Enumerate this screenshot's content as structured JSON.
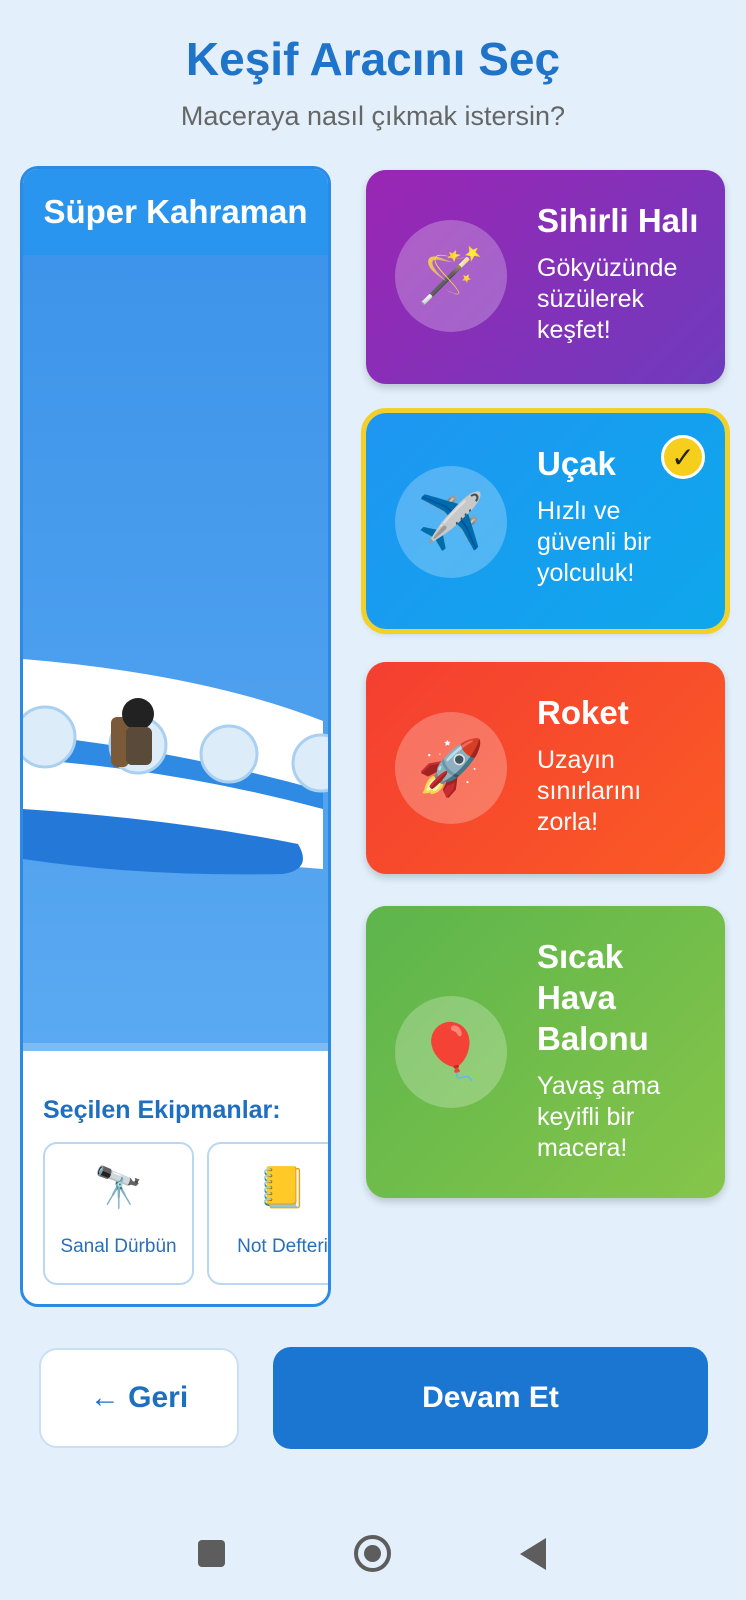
{
  "header": {
    "title": "Keşif Aracını Seç",
    "subtitle": "Maceraya nasıl çıkmak istersin?"
  },
  "preview": {
    "character_title": "Süper Kahraman",
    "equipment_title": "Seçilen Ekipmanlar:",
    "equipment": [
      {
        "icon": "🔭",
        "icon_name": "telescope-icon",
        "label": "Sanal Dürbün"
      },
      {
        "icon": "📒",
        "icon_name": "notebook-icon",
        "label": "Not Defteri"
      }
    ]
  },
  "vehicles": [
    {
      "name": "Sihirli Halı",
      "description": "Gökyüzünde süzülerek keşfet!",
      "icon": "🪄",
      "icon_name": "magic-wand-icon",
      "selected": false
    },
    {
      "name": "Uçak",
      "description": "Hızlı ve güvenli bir yolculuk!",
      "icon": "✈️",
      "icon_name": "airplane-icon",
      "selected": true
    },
    {
      "name": "Roket",
      "description": "Uzayın sınırlarını zorla!",
      "icon": "🚀",
      "icon_name": "rocket-icon",
      "selected": false
    },
    {
      "name": "Sıcak Hava Balonu",
      "description": "Yavaş ama keyifli bir macera!",
      "icon": "🎈",
      "icon_name": "balloon-icon",
      "selected": false
    }
  ],
  "check_mark": "✓",
  "buttons": {
    "back": "← Geri",
    "next": "Devam Et"
  },
  "colors": {
    "accent": "#1b76d2",
    "selected_outline": "#f2d02a",
    "magic_carpet": "#8e2bb5",
    "plane": "#1ea0f0",
    "rocket": "#f4462c",
    "balloon": "#6cb948"
  }
}
